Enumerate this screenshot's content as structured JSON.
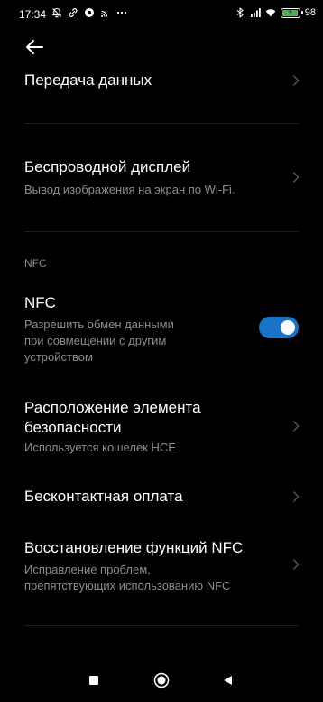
{
  "status_bar": {
    "time": "17:34",
    "left_icons": [
      "mute-notifications-icon",
      "link-icon",
      "vpn-icon",
      "cast-icon",
      "more-dots-icon"
    ],
    "right_icons": [
      "bluetooth-icon",
      "signal-icon",
      "wifi-icon"
    ],
    "battery_level": 98,
    "battery_text": "98"
  },
  "header": {
    "back_icon": "back-arrow-icon"
  },
  "items": [
    {
      "title": "Передача данных",
      "subtitle": ""
    },
    {
      "title": "Беспроводной дисплей",
      "subtitle": "Вывод изображения на экран по Wi-Fi."
    },
    {
      "title": "NFC",
      "subtitle": "Разрешить обмен данными\nпри совмещении с другим\nустройством",
      "toggle_on": true
    },
    {
      "title": "Расположение элемента\nбезопасности",
      "subtitle": "Используется кошелек HCE"
    },
    {
      "title": "Бесконтактная оплата",
      "subtitle": ""
    },
    {
      "title": "Восстановление функций NFC",
      "subtitle": "Исправление проблем,\nпрепятствующих использованию NFC"
    }
  ],
  "sections": {
    "nfc_label": "NFC"
  },
  "accent_color": "#1a73c9",
  "nav": {
    "buttons": [
      "recents-square-icon",
      "home-circle-icon",
      "back-triangle-icon"
    ]
  }
}
